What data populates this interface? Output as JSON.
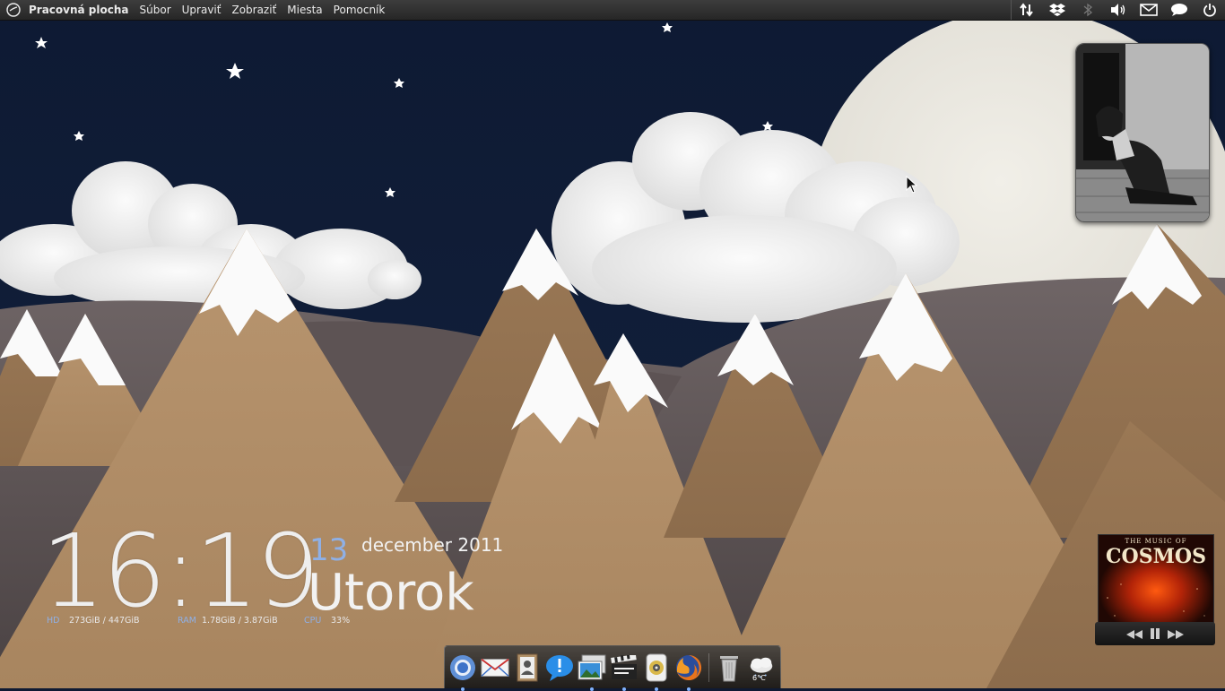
{
  "topbar": {
    "logo_icon": "elementary-logo-icon",
    "app_name": "Pracovná plocha",
    "menu": [
      "Súbor",
      "Upraviť",
      "Zobraziť",
      "Miesta",
      "Pomocník"
    ],
    "tray_icons": [
      "network-transfer-icon",
      "dropbox-icon",
      "bluetooth-icon",
      "volume-icon",
      "mail-icon",
      "chat-icon",
      "power-icon"
    ]
  },
  "clock": {
    "time": "16:19",
    "day": "13",
    "month_year": "december 2011",
    "weekday": "Utorok",
    "stats": {
      "hd_label": "HD",
      "hd_value": "273GiB  / 447GiB",
      "ram_label": "RAM",
      "ram_value": "1.78GiB / 3.87GiB",
      "cpu_label": "CPU",
      "cpu_value": "33%"
    }
  },
  "music": {
    "cover_top": "THE MUSIC OF",
    "cover_title": "COSMOS",
    "controls": [
      "previous-icon",
      "pause-icon",
      "next-icon"
    ]
  },
  "dock": {
    "items": [
      {
        "name": "chromium-icon",
        "running": true
      },
      {
        "name": "mail-client-icon",
        "running": false
      },
      {
        "name": "contacts-icon",
        "running": false
      },
      {
        "name": "messaging-icon",
        "running": false
      },
      {
        "name": "photo-manager-icon",
        "running": true
      },
      {
        "name": "video-editor-icon",
        "running": true
      },
      {
        "name": "music-player-icon",
        "running": true
      },
      {
        "name": "firefox-icon",
        "running": true
      },
      {
        "name": "trash-icon",
        "running": false
      },
      {
        "name": "weather-icon",
        "running": false
      }
    ],
    "weather_temp": "6°C"
  },
  "colors": {
    "sky": "#0f1a33",
    "moon": "#e9e7e0",
    "cardboard": "#b08d6c",
    "accent_blue": "#8fb0e6"
  }
}
